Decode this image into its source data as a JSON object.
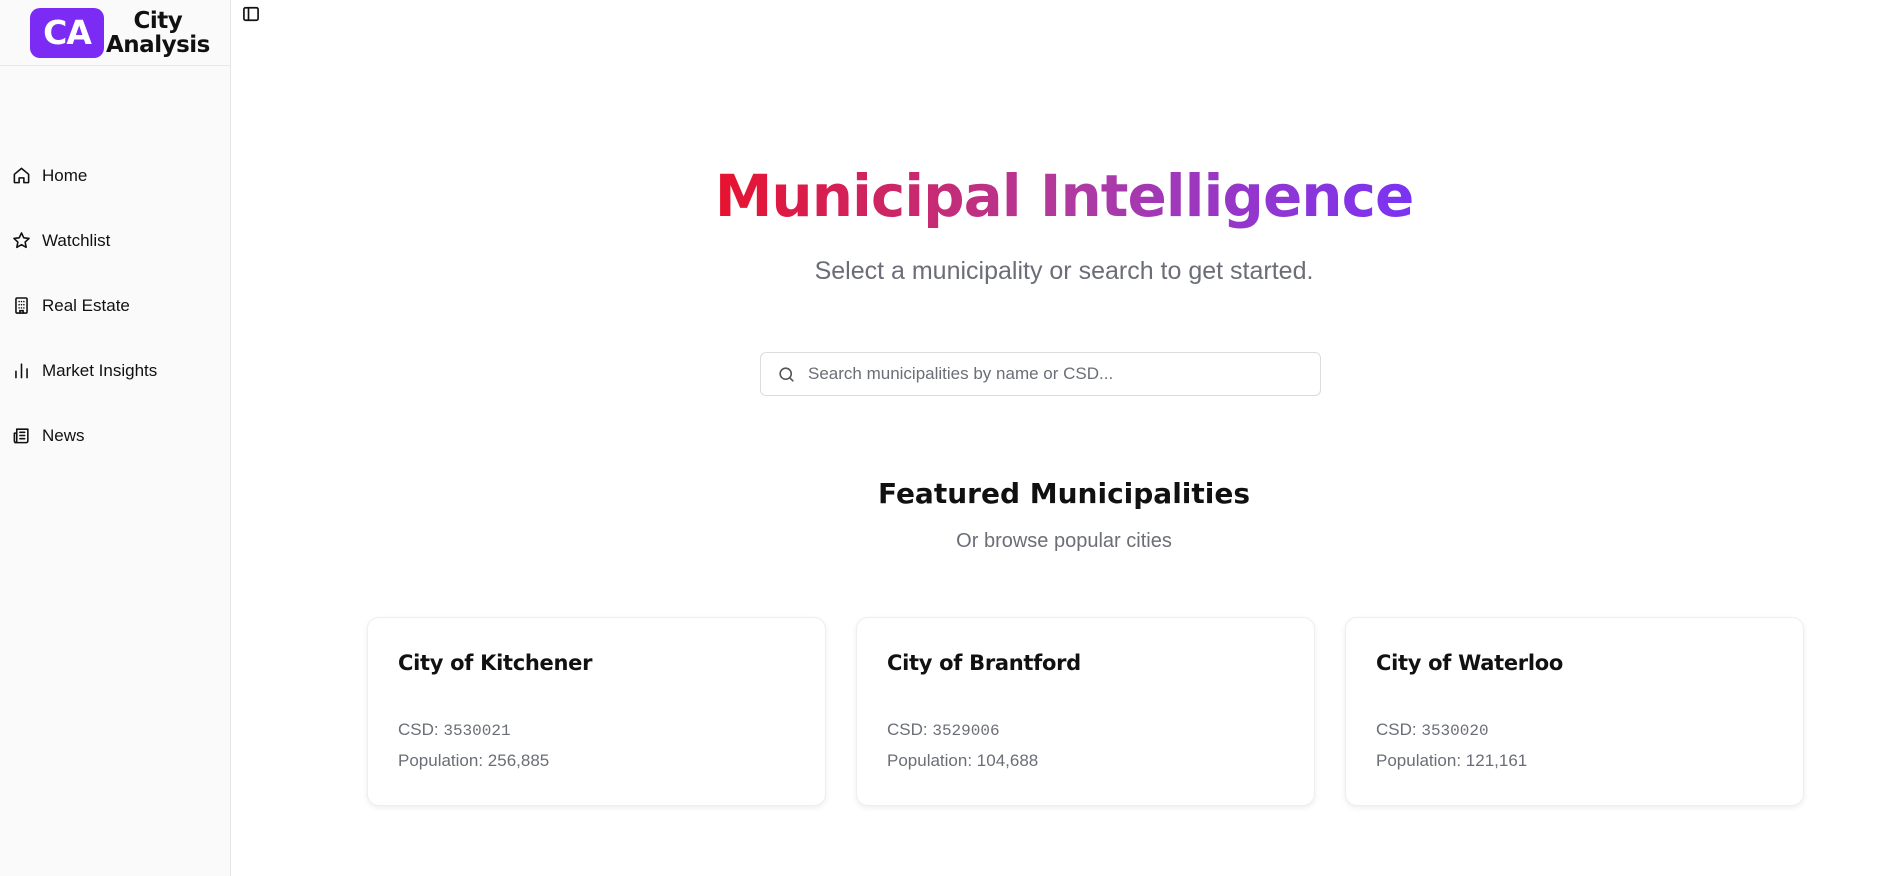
{
  "brand": {
    "logo_text": "CA",
    "name_line1": "City",
    "name_line2": "Analysis"
  },
  "sidebar": {
    "items": [
      {
        "label": "Home",
        "icon": "home-icon"
      },
      {
        "label": "Watchlist",
        "icon": "star-icon"
      },
      {
        "label": "Real Estate",
        "icon": "building-icon"
      },
      {
        "label": "Market Insights",
        "icon": "bar-chart-icon"
      },
      {
        "label": "News",
        "icon": "newspaper-icon"
      }
    ]
  },
  "hero": {
    "title": "Municipal Intelligence",
    "subtitle": "Select a municipality or search to get started.",
    "gradient": [
      "#e8122e",
      "#b13a9e",
      "#7a33f5"
    ]
  },
  "search": {
    "placeholder": "Search municipalities by name or CSD...",
    "value": ""
  },
  "featured": {
    "title": "Featured Municipalities",
    "subtitle": "Or browse popular cities",
    "csd_label": "CSD: ",
    "population_label": "Population: ",
    "cards": [
      {
        "name": "City of Kitchener",
        "csd": "3530021",
        "population": "256,885"
      },
      {
        "name": "City of Brantford",
        "csd": "3529006",
        "population": "104,688"
      },
      {
        "name": "City of Waterloo",
        "csd": "3530020",
        "population": "121,161"
      }
    ]
  },
  "colors": {
    "brand": "#7c2bf5",
    "muted_text": "#6b6e76",
    "sidebar_bg": "#fafafa"
  }
}
